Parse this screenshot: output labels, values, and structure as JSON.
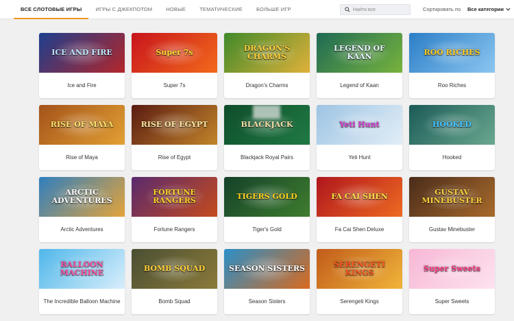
{
  "tabs": [
    {
      "label": "ВСЕ СЛОТОВЫЕ ИГРЫ",
      "active": true
    },
    {
      "label": "ИГРЫ С ДЖЕКПОТОМ",
      "active": false
    },
    {
      "label": "НОВЫЕ",
      "active": false
    },
    {
      "label": "ТЕМАТИЧЕСКИЕ",
      "active": false
    },
    {
      "label": "БОЛЬШЕ ИГР",
      "active": false
    }
  ],
  "search": {
    "placeholder": "Найти все"
  },
  "sort": {
    "label": "Сортировать по",
    "selected": "Все категории"
  },
  "accent_color": "#f7941d",
  "games": [
    {
      "name": "Ice and Fire",
      "logo": "ICE AND FIRE",
      "logo_color": "#bfe8ff",
      "bg": [
        "#1d3f8f",
        "#b3262a"
      ]
    },
    {
      "name": "Super 7s",
      "logo": "Super 7s",
      "logo_color": "#ffdd2e",
      "bg": [
        "#c8141c",
        "#f26a1b"
      ]
    },
    {
      "name": "Dragon's Charms",
      "logo": "DRAGON'S CHARMS",
      "logo_color": "#ffd23a",
      "bg": [
        "#3f8a2a",
        "#e0b13a"
      ]
    },
    {
      "name": "Legend of Kaan",
      "logo": "LEGEND OF KAAN",
      "logo_color": "#e9f7ff",
      "bg": [
        "#1e6a55",
        "#78b33c"
      ]
    },
    {
      "name": "Roo Riches",
      "logo": "ROO RICHES",
      "logo_color": "#ffcc1f",
      "bg": [
        "#2b7ec7",
        "#8cc6f0"
      ]
    },
    {
      "name": "Rise of Maya",
      "logo": "RISE OF MAYA",
      "logo_color": "#ffe36b",
      "bg": [
        "#a4531a",
        "#e2a034"
      ]
    },
    {
      "name": "Rise of Egypt",
      "logo": "RISE OF EGYPT",
      "logo_color": "#ffe9a3",
      "bg": [
        "#5a1b12",
        "#c2852a"
      ]
    },
    {
      "name": "Blackjack Royal Pairs",
      "logo": "BLACKJACK",
      "logo_color": "#f2e2a8",
      "bg": [
        "#0f4d2b",
        "#1f7a44"
      ]
    },
    {
      "name": "Yeti Hunt",
      "logo": "Yeti Hunt",
      "logo_color": "#d63bd1",
      "bg": [
        "#9dc4e3",
        "#e3eef7"
      ]
    },
    {
      "name": "Hooked",
      "logo": "HOOKED",
      "logo_color": "#42c3ff",
      "bg": [
        "#1b5b57",
        "#6aa890"
      ]
    },
    {
      "name": "Arctic Adventures",
      "logo": "ARCTIC ADVENTURES",
      "logo_color": "#ffffff",
      "bg": [
        "#2f7fbf",
        "#e4a33a"
      ]
    },
    {
      "name": "Fortune Rangers",
      "logo": "FORTUNE RANGERS",
      "logo_color": "#ffd12b",
      "bg": [
        "#5a2a6e",
        "#c44b1c"
      ]
    },
    {
      "name": "Tiger's Gold",
      "logo": "TIGERS GOLD",
      "logo_color": "#ffd21f",
      "bg": [
        "#14422a",
        "#3f7d2e"
      ]
    },
    {
      "name": "Fa Cai Shen Deluxe",
      "logo": "FA CAI SHEN",
      "logo_color": "#ffe04a",
      "bg": [
        "#b0161c",
        "#ee6a22"
      ]
    },
    {
      "name": "Gustav Minebuster",
      "logo": "GUSTAV MINEBUSTER",
      "logo_color": "#ffcf3a",
      "bg": [
        "#4a2c1a",
        "#a86a2c"
      ]
    },
    {
      "name": "The Incredible Balloon Machine",
      "logo": "BALLOON MACHINE",
      "logo_color": "#ff4fa3",
      "bg": [
        "#4fb7ea",
        "#d9eefb"
      ]
    },
    {
      "name": "Bomb Squad",
      "logo": "BOMB SQUAD",
      "logo_color": "#ffd13b",
      "bg": [
        "#4a4f33",
        "#8b7a3a"
      ]
    },
    {
      "name": "Season Sisters",
      "logo": "SEASON SISTERS",
      "logo_color": "#ffffff",
      "bg": [
        "#2b8fc7",
        "#d86a1f"
      ]
    },
    {
      "name": "Serengeti Kings",
      "logo": "SERENGETI KINGS",
      "logo_color": "#ff5a1f",
      "bg": [
        "#c15b1a",
        "#f0b53a"
      ]
    },
    {
      "name": "Super Sweets",
      "logo": "Super Sweets",
      "logo_color": "#ff3d8b",
      "bg": [
        "#f7b7d6",
        "#fde3ef"
      ]
    }
  ]
}
